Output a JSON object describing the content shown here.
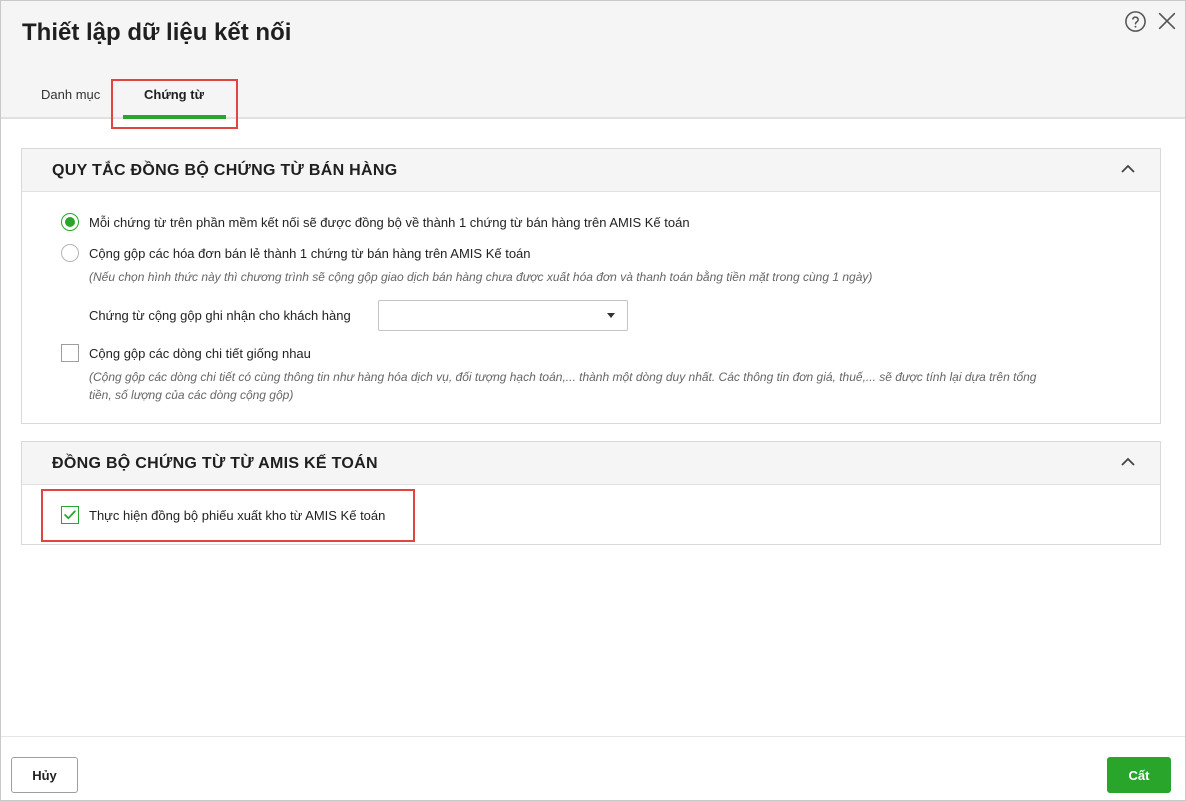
{
  "dialog": {
    "title": "Thiết lập dữ liệu kết nối",
    "help_icon": "help-circle-icon",
    "close_icon": "close-icon"
  },
  "tabs": [
    {
      "label": "Danh mục",
      "active": false
    },
    {
      "label": "Chứng từ",
      "active": true
    }
  ],
  "section_sales": {
    "title": "QUY TẮC ĐỒNG BỘ CHỨNG TỪ BÁN HÀNG",
    "collapse_icon": "chevron-up-icon",
    "option_single": {
      "label": "Mỗi chứng từ trên phần mềm kết nối sẽ được đồng bộ về thành 1 chứng từ bán hàng trên AMIS Kế toán",
      "selected": true
    },
    "option_merge": {
      "label": "Cộng gộp các hóa đơn bán lẻ thành 1 chứng từ bán hàng trên AMIS Kế toán",
      "note": "(Nếu chọn hình thức này thì chương trình sẽ cộng gộp giao dịch bán hàng chưa được xuất hóa đơn và thanh toán bằng tiền mặt trong cùng 1 ngày)",
      "selected": false
    },
    "customer_field": {
      "label": "Chứng từ cộng gộp ghi nhận cho khách hàng",
      "value": ""
    },
    "merge_lines": {
      "label": "Cộng gộp các dòng chi tiết giống nhau",
      "note_line1": "(Cộng gộp các dòng chi tiết có cùng thông tin như hàng hóa dịch vụ, đối tượng hạch toán,... thành một dòng duy nhất. Các thông tin đơn giá, thuế,... sẽ được tính lại dựa trên tổng",
      "note_line2": "tiền, số lượng của các dòng cộng gộp)",
      "checked": false
    }
  },
  "section_sync": {
    "title": "ĐỒNG BỘ CHỨNG TỪ TỪ AMIS KẾ TOÁN",
    "collapse_icon": "chevron-up-icon",
    "sync_stock": {
      "label": "Thực hiện đồng bộ phiếu xuất kho từ AMIS Kế toán",
      "checked": true
    }
  },
  "footer": {
    "cancel_label": "Hủy",
    "save_label": "Cất"
  },
  "colors": {
    "accent": "#2aa52c",
    "highlight": "#e0463f",
    "header_bg": "#f5f5f5"
  }
}
